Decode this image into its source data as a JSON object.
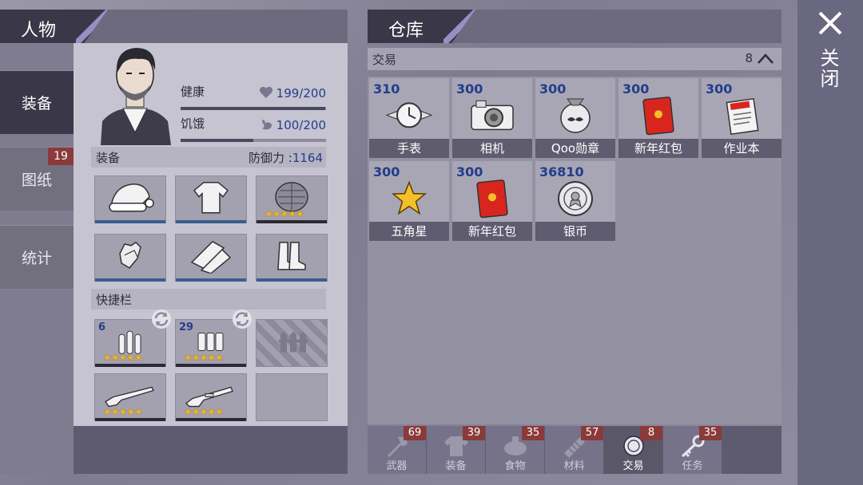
{
  "left": {
    "title": "人物",
    "tabs": [
      {
        "label": "装备",
        "active": true,
        "badge": ""
      },
      {
        "label": "图纸",
        "active": false,
        "badge": "19"
      },
      {
        "label": "统计",
        "active": false,
        "badge": ""
      }
    ],
    "stats": [
      {
        "label": "健康",
        "value": "199/200",
        "fraction": 0.995,
        "icon": "heart-icon"
      },
      {
        "label": "饥饿",
        "value": "100/200",
        "fraction": 0.5,
        "icon": "stomach-icon"
      }
    ],
    "equipment": {
      "label": "装备",
      "defense_label": "防御力 :",
      "defense_value": "1164"
    },
    "gear_slots": [
      {
        "icon": "santa-hat-icon",
        "stars": ""
      },
      {
        "icon": "sweater-icon",
        "stars": ""
      },
      {
        "icon": "vest-icon",
        "stars": "★★★★★"
      },
      {
        "icon": "gloves-icon",
        "stars": ""
      },
      {
        "icon": "pants-icon",
        "stars": ""
      },
      {
        "icon": "boots-icon",
        "stars": ""
      }
    ],
    "quickbar": {
      "label": "快捷栏"
    },
    "quick_slots": [
      {
        "icon": "ammo-icon",
        "count": "6",
        "stars": "★★★★★"
      },
      {
        "icon": "shells-icon",
        "count": "29",
        "stars": "★★★★★"
      },
      {
        "icon": "fence-icon",
        "count": "",
        "stars": "",
        "locked": true
      },
      {
        "icon": "shotgun-icon",
        "count": "",
        "stars": "★★★★★"
      },
      {
        "icon": "rifle-icon",
        "count": "",
        "stars": "★★★★★"
      },
      {
        "icon": "empty-slot",
        "count": "",
        "stars": ""
      }
    ]
  },
  "right": {
    "title": "仓库",
    "section": {
      "label": "交易",
      "count": "8"
    },
    "items": [
      {
        "value": "310",
        "name": "手表",
        "icon": "watch-icon"
      },
      {
        "value": "300",
        "name": "相机",
        "icon": "camera-icon"
      },
      {
        "value": "300",
        "name": "Qoo勋章",
        "icon": "medal-icon"
      },
      {
        "value": "300",
        "name": "新年红包",
        "icon": "red-envelope-icon"
      },
      {
        "value": "300",
        "name": "作业本",
        "icon": "notebook-icon"
      },
      {
        "value": "300",
        "name": "五角星",
        "icon": "star-icon"
      },
      {
        "value": "300",
        "name": "新年红包",
        "icon": "red-envelope-icon"
      },
      {
        "value": "36810",
        "name": "银币",
        "icon": "silver-coin-icon"
      }
    ],
    "categories": [
      {
        "label": "武器",
        "badge": "69",
        "icon": "axe-icon",
        "active": false
      },
      {
        "label": "装备",
        "badge": "39",
        "icon": "shirt-icon",
        "active": false
      },
      {
        "label": "食物",
        "badge": "35",
        "icon": "food-icon",
        "active": false
      },
      {
        "label": "材料",
        "badge": "57",
        "icon": "material-icon",
        "active": false
      },
      {
        "label": "交易",
        "badge": "8",
        "icon": "coin-icon",
        "active": true
      },
      {
        "label": "任务",
        "badge": "35",
        "icon": "key-icon",
        "active": false
      }
    ]
  },
  "close": {
    "label": "关闭"
  },
  "colors": {
    "value_blue": "#233d8a",
    "badge_red": "#8a3a3a",
    "star_gold": "#f3b623",
    "panel_dark": "#3a3848"
  }
}
